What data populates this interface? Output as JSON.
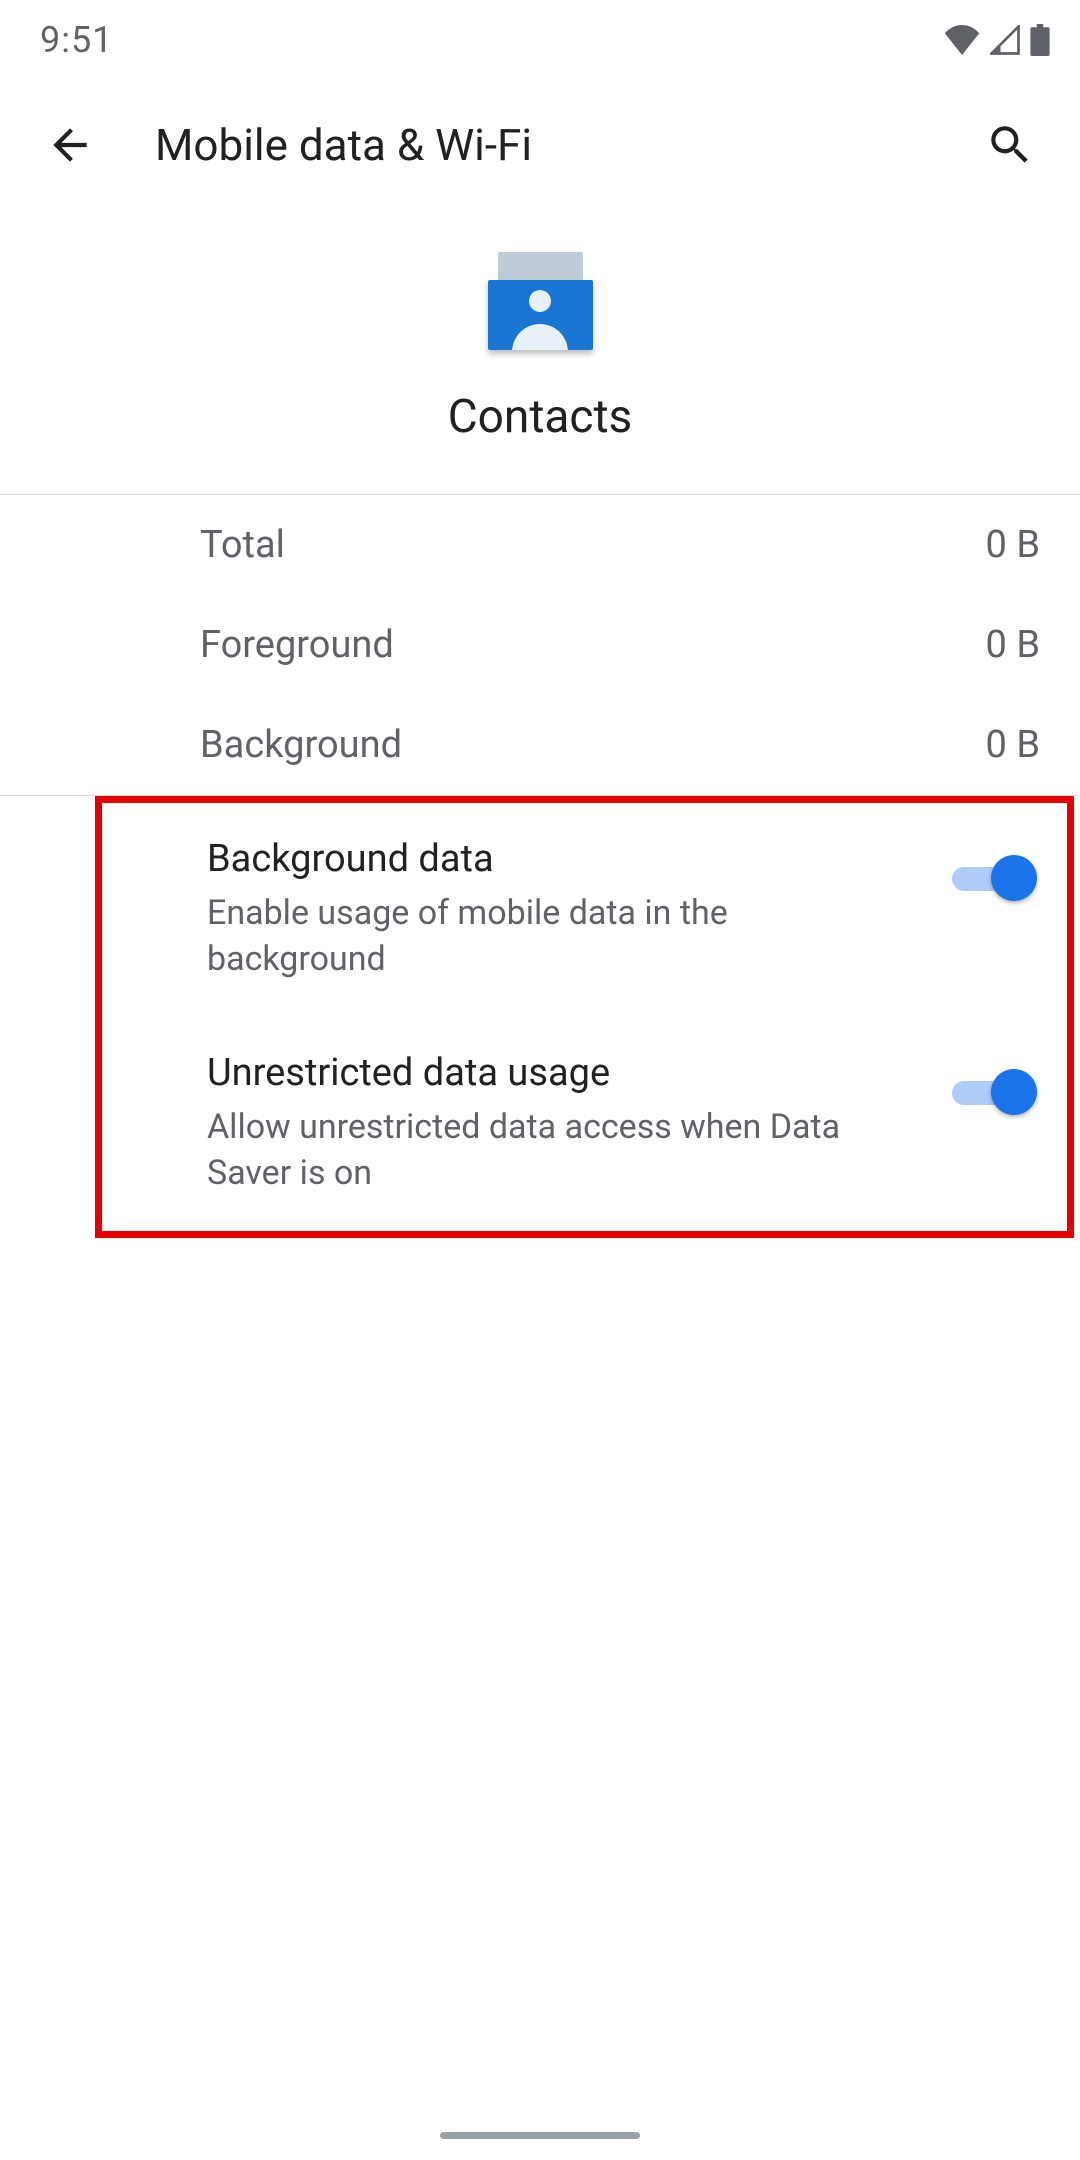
{
  "statusbar": {
    "time": "9:51"
  },
  "header": {
    "title": "Mobile data & Wi-Fi"
  },
  "app": {
    "name": "Contacts"
  },
  "usage": {
    "total_label": "Total",
    "total_value": "0 B",
    "foreground_label": "Foreground",
    "foreground_value": "0 B",
    "background_label": "Background",
    "background_value": "0 B"
  },
  "settings": {
    "background_data": {
      "title": "Background data",
      "subtitle": "Enable usage of mobile data in the background",
      "enabled": true
    },
    "unrestricted": {
      "title": "Unrestricted data usage",
      "subtitle": "Allow unrestricted data access when Data Saver is on",
      "enabled": true
    }
  }
}
